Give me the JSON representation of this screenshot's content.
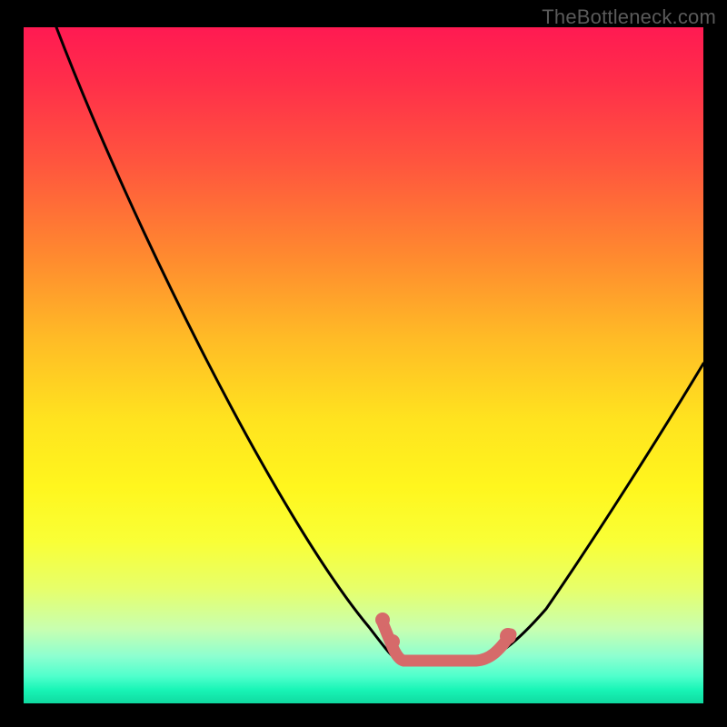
{
  "watermark": "TheBottleneck.com",
  "chart_data": {
    "type": "line",
    "title": "",
    "xlabel": "",
    "ylabel": "",
    "x": [
      0.05,
      0.15,
      0.25,
      0.35,
      0.45,
      0.5,
      0.55,
      0.6,
      0.65,
      0.7,
      0.8,
      0.9,
      1.0
    ],
    "series": [
      {
        "name": "curve",
        "values": [
          1.0,
          0.78,
          0.56,
          0.36,
          0.18,
          0.11,
          0.06,
          0.05,
          0.05,
          0.07,
          0.17,
          0.35,
          0.5
        ],
        "color": "#000000"
      }
    ],
    "highlight_range_x": [
      0.53,
      0.72
    ],
    "highlight_color": "#d66a6a",
    "background_gradient": {
      "top": "#ff1a52",
      "mid": "#ffe31f",
      "bottom": "#10d9a0"
    },
    "xlim": [
      0,
      1
    ],
    "ylim": [
      0,
      1
    ],
    "grid": false,
    "legend": false,
    "note": "Axes carry no visible tick labels in the source image; x and y are normalized 0–1. Values are estimated from the rendered curve shape."
  }
}
